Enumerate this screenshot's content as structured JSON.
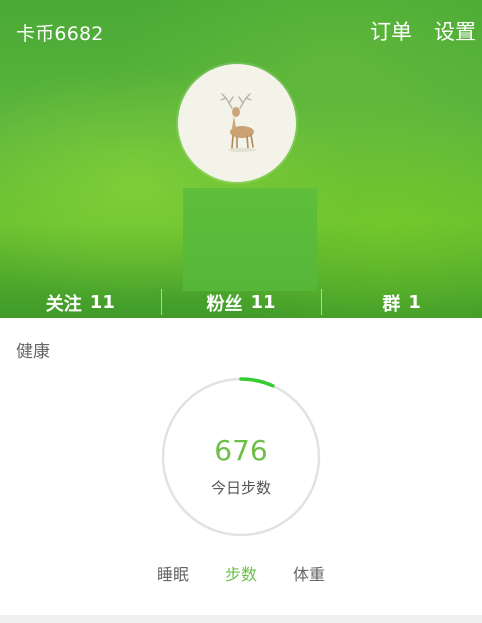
{
  "header": {
    "coins_label": "卡币6682",
    "orders_label": "订单",
    "settings_label": "设置"
  },
  "stats": [
    {
      "label": "关注",
      "count": "11"
    },
    {
      "label": "粉丝",
      "count": "11"
    },
    {
      "label": "群",
      "count": "1"
    }
  ],
  "health": {
    "section_title": "健康",
    "steps_value": "676",
    "steps_label": "今日步数",
    "goal_progress_fraction": 0.067,
    "ring_progress_color": "#33cc33",
    "ring_track_color": "#e2e2e2"
  },
  "tabs": [
    {
      "label": "睡眠",
      "active": false
    },
    {
      "label": "步数",
      "active": true
    },
    {
      "label": "体重",
      "active": false
    }
  ],
  "colors": {
    "accent_green": "#6cc04a",
    "header_green": "#5bb53c"
  }
}
